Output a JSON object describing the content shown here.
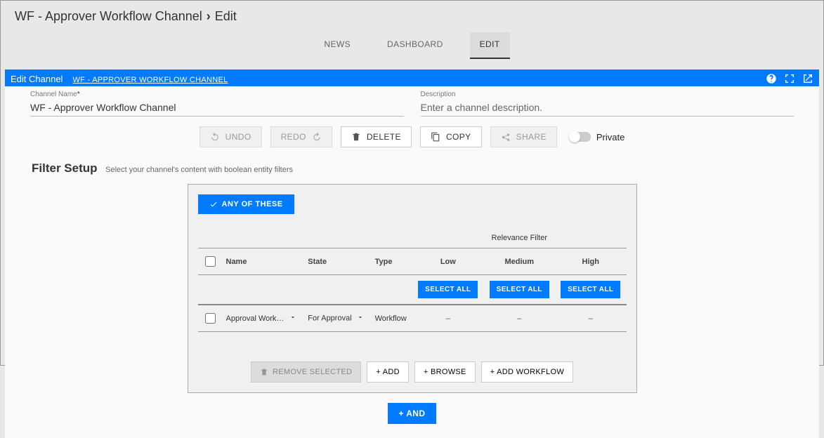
{
  "breadcrumb": {
    "root": "WF - Approver Workflow Channel",
    "page": "Edit"
  },
  "tabs": {
    "news": "NEWS",
    "dashboard": "DASHBOARD",
    "edit": "EDIT"
  },
  "panel": {
    "title": "Edit Channel",
    "subtitle": "WF - APPROVER WORKFLOW CHANNEL"
  },
  "fields": {
    "name_label": "Channel Name",
    "name_value": "WF - Approver Workflow Channel",
    "desc_label": "Description",
    "desc_placeholder": "Enter a channel description."
  },
  "toolbar": {
    "undo": "UNDO",
    "redo": "REDO",
    "delete": "DELETE",
    "copy": "COPY",
    "share": "SHARE",
    "private": "Private"
  },
  "section": {
    "title": "Filter Setup",
    "subtitle": "Select your channel's content with boolean entity filters"
  },
  "filter": {
    "any_of": "ANY OF THESE",
    "relevance_header": "Relevance Filter",
    "columns": {
      "name": "Name",
      "state": "State",
      "type": "Type",
      "low": "Low",
      "medium": "Medium",
      "high": "High"
    },
    "select_all": "SELECT ALL",
    "rows": [
      {
        "name": "Approval Workflow",
        "state": "For Approval",
        "type": "Workflow",
        "low": "–",
        "medium": "–",
        "high": "–"
      }
    ],
    "actions": {
      "remove": "REMOVE SELECTED",
      "add": "+ ADD",
      "browse": "+ BROWSE",
      "add_workflow": "+ ADD WORKFLOW"
    },
    "and": "+ AND"
  }
}
